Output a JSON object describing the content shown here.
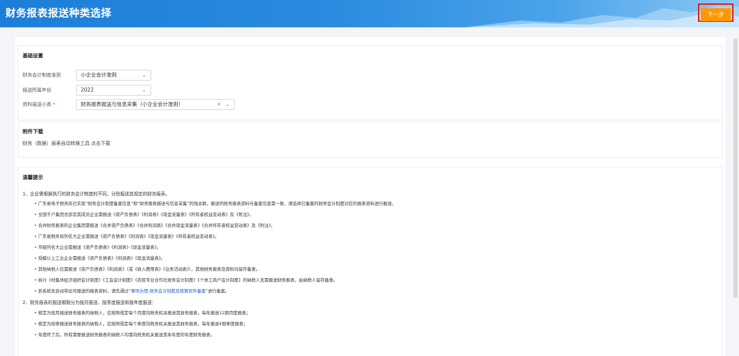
{
  "header": {
    "title": "财务报表报送种类选择",
    "next_label": "下一步"
  },
  "basic": {
    "title": "基础设置",
    "standard_label": "财务会计制度准则",
    "standard_value": "小企业会计准则",
    "year_label": "报送所属年份",
    "year_value": "2022",
    "subtype_label": "资料报送小类",
    "required_mark": "*",
    "subtype_value": "财务报表报送与信息采集（小企业会计准则）"
  },
  "attach": {
    "title": "附件下载",
    "text": "财务（数据）报表自动转换工具 点击下载"
  },
  "tips": {
    "title": "温馨提示",
    "l1": "1、企业需根据执行的财务会计制度的不同，分别报送其规定的财务报表。",
    "b1": "• 广东省电子税务局已实现“财务会计制度备案信息”和“财务报表报送与信息采集”的强关联，报送的财务报表资料与备案信息需一致，请选择已备案的财务会计制度对应的报表资料进行报送。",
    "b2": "• 全国千户集团总部及其成员企业需报送《资产负债表》《利润表》《现金流量表》《所有者权益变动表》及《附注》。",
    "b3": "• 合并财务报表的企业集团需报送《合并资产负债表》《合并利润表》《合并现金流量表》《合并所有者权益变动表》及《附注》。",
    "b4": "• 广东省税务局列名大企业需报送《资产负债表》《利润表》《现金流量表》《所有者权益变动表》。",
    "b5": "• 市级列名大企业需报送《资产负债表》《利润表》《现金流量表》。",
    "b6": "• 规模以上工业企业需报送《资产负债表》《利润表》《现金流量表》。",
    "b7": "• 其他纳税人仅需报送《资产负债表》《利润表》（或《收入费用表》《业务活动表》），其他财务报表及资料均留存备查。",
    "b8": "• 执行《村集体经济组织会计制度》《工会会计制度》《农民专业合作社财务会计制度》《个体工商户会计制度》的纳税人无需报送财务报表，由纳税人留存备查。",
    "b9_pre": "• 若系统无自动带出可报送的报表资料，请先通过“",
    "b9_link": "事项办理-财务会计制度及核算软件备案",
    "b9_post": "”进行备案。",
    "l2": "2、财务报表的报送期限分为按月报送、按季度报送和按年度报送：",
    "c1": "• 核定为按月报送财务报表的纳税人，应按照规定每个月度向税务机关报送其财务报表，每年报送12期月度报表；",
    "c2": "• 核定为按季报送财务报表的纳税人，应按照规定每个季度向税务机关报送其财务报表，每年报送4期季度报表；",
    "c3": "• 年度终了后，所有需要报送财务报表的纳税人均需向税务机关报送其本年度的年度财务报表。"
  }
}
